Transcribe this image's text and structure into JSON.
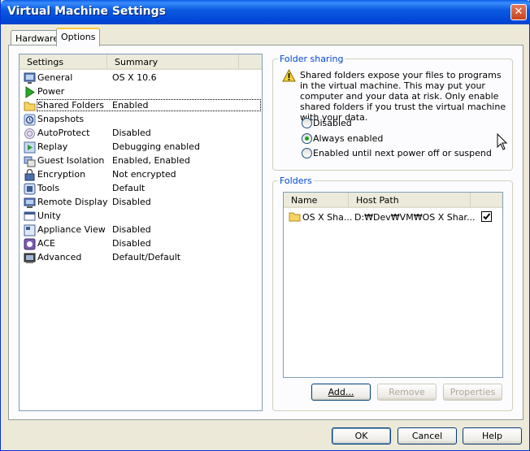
{
  "window": {
    "title": "Virtual Machine Settings",
    "close_symbol": "✕"
  },
  "tabs": [
    {
      "label": "Hardware",
      "active": false
    },
    {
      "label": "Options",
      "active": true
    }
  ],
  "settings_list": {
    "columns": [
      "Settings",
      "Summary"
    ],
    "items": [
      {
        "name": "General",
        "summary": "OS X 10.6",
        "icon": "monitor-icon"
      },
      {
        "name": "Power",
        "summary": "",
        "icon": "play-icon"
      },
      {
        "name": "Shared Folders",
        "summary": "Enabled",
        "icon": "folder-icon",
        "selected": true
      },
      {
        "name": "Snapshots",
        "summary": "",
        "icon": "snapshot-icon"
      },
      {
        "name": "AutoProtect",
        "summary": "Disabled",
        "icon": "autoprotect-icon"
      },
      {
        "name": "Replay",
        "summary": "Debugging enabled",
        "icon": "replay-icon"
      },
      {
        "name": "Guest Isolation",
        "summary": "Enabled, Enabled",
        "icon": "guest-isolation-icon"
      },
      {
        "name": "Encryption",
        "summary": "Not encrypted",
        "icon": "lock-icon"
      },
      {
        "name": "Tools",
        "summary": "Default",
        "icon": "tools-icon"
      },
      {
        "name": "Remote Display",
        "summary": "Disabled",
        "icon": "remote-display-icon"
      },
      {
        "name": "Unity",
        "summary": "",
        "icon": "unity-icon"
      },
      {
        "name": "Appliance View",
        "summary": "Disabled",
        "icon": "appliance-view-icon"
      },
      {
        "name": "ACE",
        "summary": "Disabled",
        "icon": "ace-icon"
      },
      {
        "name": "Advanced",
        "summary": "Default/Default",
        "icon": "advanced-icon"
      }
    ]
  },
  "folder_sharing": {
    "label": "Folder sharing",
    "warning_text": "Shared folders expose your files to programs in the virtual machine. This may put your computer and your data at risk. Only enable shared folders if you trust the virtual machine with your data.",
    "options": [
      {
        "label": "Disabled",
        "checked": false
      },
      {
        "label": "Always enabled",
        "checked": true
      },
      {
        "label": "Enabled until next power off or suspend",
        "checked": false
      }
    ]
  },
  "folders": {
    "label": "Folders",
    "columns": [
      "Name",
      "Host Path"
    ],
    "rows": [
      {
        "name": "OS X Sha...",
        "host_path": "D:₩Dev₩VM₩OS X Shar...",
        "checked": true
      }
    ],
    "buttons": {
      "add": "Add...",
      "remove": "Remove",
      "properties": "Properties"
    }
  },
  "dialog_buttons": {
    "ok": "OK",
    "cancel": "Cancel",
    "help": "Help"
  },
  "colors": {
    "title_bar": "#0054e3",
    "group_label": "#0046d5",
    "radio_checked": "#21a121"
  }
}
